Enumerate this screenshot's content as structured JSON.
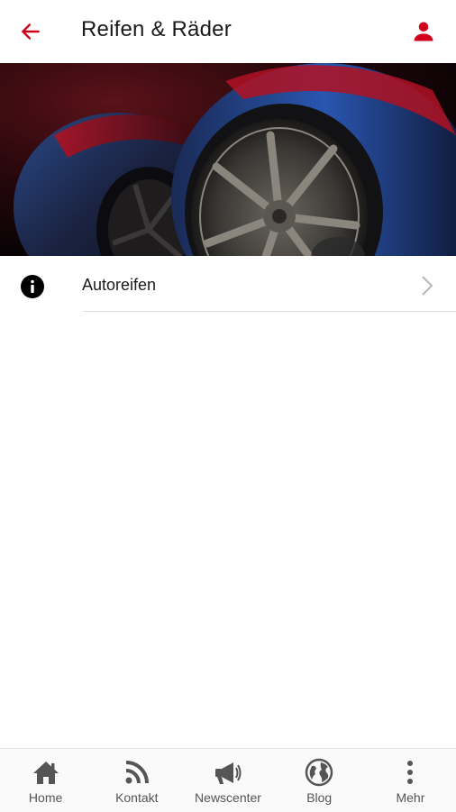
{
  "header": {
    "title": "Reifen & Räder",
    "back_icon": "arrow-left-icon",
    "profile_icon": "user-icon",
    "accent_color": "#d0021b"
  },
  "hero": {
    "image": "tires-wheels-photo"
  },
  "list": {
    "items": [
      {
        "label": "Autoreifen",
        "icon": "info-icon",
        "trailing_icon": "chevron-right-icon"
      }
    ]
  },
  "bottom_nav": {
    "items": [
      {
        "label": "Home",
        "icon": "home-icon"
      },
      {
        "label": "Kontakt",
        "icon": "rss-icon"
      },
      {
        "label": "Newscenter",
        "icon": "megaphone-icon"
      },
      {
        "label": "Blog",
        "icon": "globe-icon"
      },
      {
        "label": "Mehr",
        "icon": "more-vertical-icon"
      }
    ],
    "icon_color": "#555555"
  }
}
